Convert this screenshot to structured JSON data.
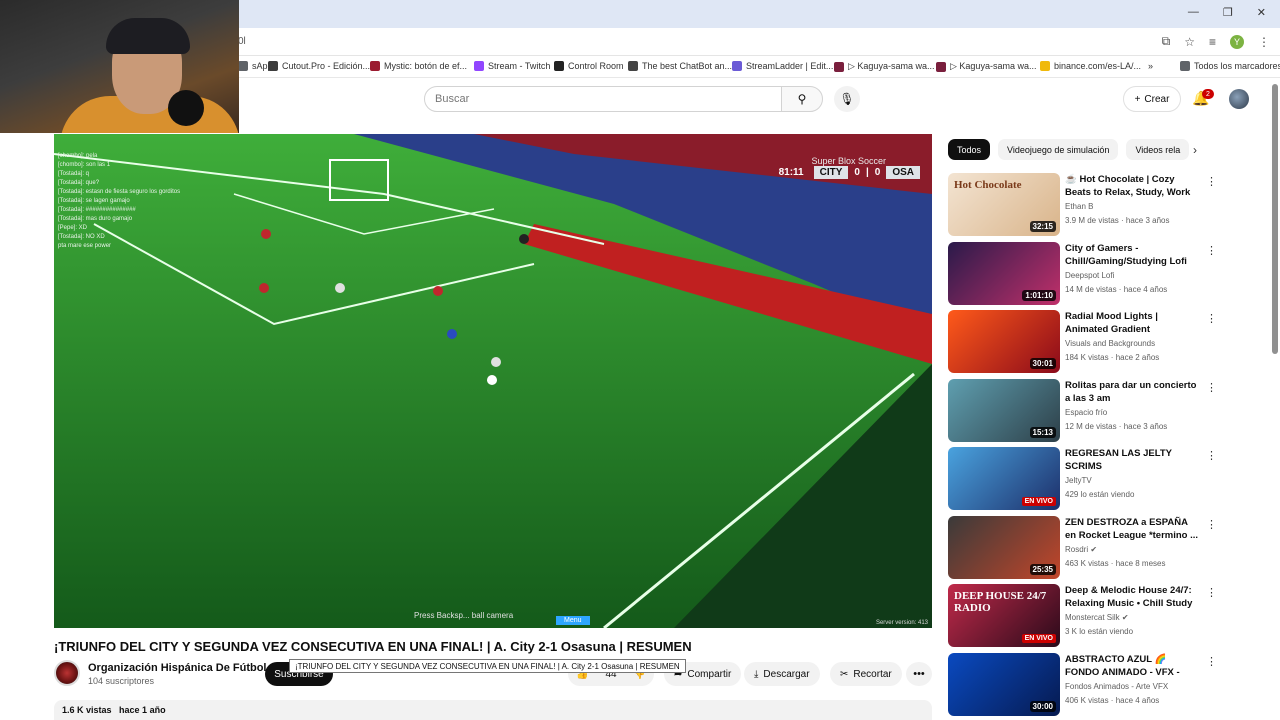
{
  "browser": {
    "url": "0l",
    "bookmarks": [
      {
        "label": "sApp",
        "color": "#5f6368"
      },
      {
        "label": "Cutout.Pro - Edición...",
        "color": "#3c3c3c"
      },
      {
        "label": "Mystic: botón de ef...",
        "color": "#9b1b30"
      },
      {
        "label": "Stream - Twitch",
        "color": "#9146ff"
      },
      {
        "label": "Control Room",
        "color": "#222222"
      },
      {
        "label": "The best ChatBot an...",
        "color": "#444444"
      },
      {
        "label": "StreamLadder | Edit...",
        "color": "#6b5bd6"
      },
      {
        "label": "▷ Kaguya-sama wa...",
        "color": "#7a1f3d"
      },
      {
        "label": "▷ Kaguya-sama wa...",
        "color": "#7a1f3d"
      },
      {
        "label": "binance.com/es-LA/...",
        "color": "#f0b90b"
      },
      {
        "label": "»",
        "color": ""
      },
      {
        "label": "Todos los marcadores",
        "color": "#5f6368"
      }
    ],
    "profile_letter": "Y"
  },
  "masthead": {
    "search_placeholder": "Buscar",
    "create_label": "Crear",
    "notification_count": "2"
  },
  "player": {
    "game_title": "Super Blox Soccer",
    "clock": "81:11",
    "home_team": "CITY",
    "home_score": "0",
    "away_score": "0",
    "away_team": "OSA",
    "chat": [
      "[chombo]: pela",
      "[chombo]: son las 1",
      "[Tostada]: q",
      "[Tostada]: que?",
      "[Tostada]: estasn de fiesta seguro los gorditos",
      "[Tostada]: se lagen gamajo",
      "[Tostada]: ###############",
      "[Tostada]: mas duro gamajo",
      "[Pepe]: XD",
      "[Tostada]: NO XD",
      "pta mare ese power"
    ],
    "bottom_hint": "Press Backsp... ball camera",
    "menu_label": "Menu",
    "server_version": "Server version: 413"
  },
  "video": {
    "title": "¡TRIUNFO DEL CITY Y SEGUNDA VEZ CONSECUTIVA EN UNA FINAL! | A. City 2-1 Osasuna | RESUMEN",
    "tooltip": "¡TRIUNFO DEL CITY Y SEGUNDA VEZ CONSECUTIVA EN UNA FINAL! | A. City 2-1 Osasuna | RESUMEN",
    "channel_name": "Organización Hispánica De Fútbol",
    "subscribers": "104 suscriptores",
    "subscribe_label": "Suscribirse",
    "like_count": "44",
    "share_label": "Compartir",
    "download_label": "Descargar",
    "clip_label": "Recortar",
    "views": "1.6 K vistas",
    "age": "hace 1 año"
  },
  "sidebar": {
    "chips": [
      "Todos",
      "Videojuego de simulación",
      "Videos rela"
    ],
    "items": [
      {
        "title": "☕ Hot Chocolate | Cozy Beats to Relax, Study, Work",
        "channel": "Ethan B",
        "meta": "3.9 M de vistas · hace 3 años",
        "duration": "32:15",
        "live": "",
        "thumb_overlay": "Hot Chocolate",
        "c1": "#f3e4d2",
        "c2": "#d9b48a"
      },
      {
        "title": "City of Gamers - Chill/Gaming/Studying Lofi Hi...",
        "channel": "Deepspot Lofi",
        "meta": "14 M de vistas · hace 4 años",
        "duration": "1:01:10",
        "live": "",
        "thumb_overlay": "",
        "c1": "#2a1a4a",
        "c2": "#c0306a"
      },
      {
        "title": "Radial Mood Lights | Animated Gradient Background",
        "channel": "Visuals and Backgrounds",
        "meta": "184 K vistas · hace 2 años",
        "duration": "30:01",
        "live": "",
        "thumb_overlay": "",
        "c1": "#ff5a1a",
        "c2": "#8a0a1a"
      },
      {
        "title": "Rolitas para dar un concierto a las 3 am",
        "channel": "Espacio frío",
        "meta": "12 M de vistas · hace 3 años",
        "duration": "15:13",
        "live": "",
        "thumb_overlay": "",
        "c1": "#5f9fb0",
        "c2": "#2d3f48"
      },
      {
        "title": "REGRESAN LAS JELTY SCRIMS",
        "channel": "JeltyTV",
        "meta": "429 lo están viendo",
        "duration": "",
        "live": "EN VIVO",
        "thumb_overlay": "",
        "c1": "#4aa3df",
        "c2": "#1d2f6a"
      },
      {
        "title": "ZEN DESTROZA a ESPAÑA en Rocket League *termino ...",
        "channel": "Rosdri ✔",
        "meta": "463 K vistas · hace 8 meses",
        "duration": "25:35",
        "live": "",
        "thumb_overlay": "",
        "c1": "#3a3a3a",
        "c2": "#c2462a"
      },
      {
        "title": "Deep & Melodic House 24/7: Relaxing Music • Chill Study ...",
        "channel": "Monstercat Silk ✔",
        "meta": "3 K lo están viendo",
        "duration": "",
        "live": "EN VIVO",
        "thumb_overlay": "DEEP HOUSE 24/7 RADIO",
        "c1": "#c02a4a",
        "c2": "#2a0a1a"
      },
      {
        "title": "ABSTRACTO AZUL 🌈 FONDO ANIMADO - VFX - GRATIS ✅ ...",
        "channel": "Fondos Animados - Arte VFX",
        "meta": "406 K vistas · hace 4 años",
        "duration": "30:00",
        "live": "",
        "thumb_overlay": "",
        "c1": "#0a4ac0",
        "c2": "#061a50"
      }
    ]
  }
}
